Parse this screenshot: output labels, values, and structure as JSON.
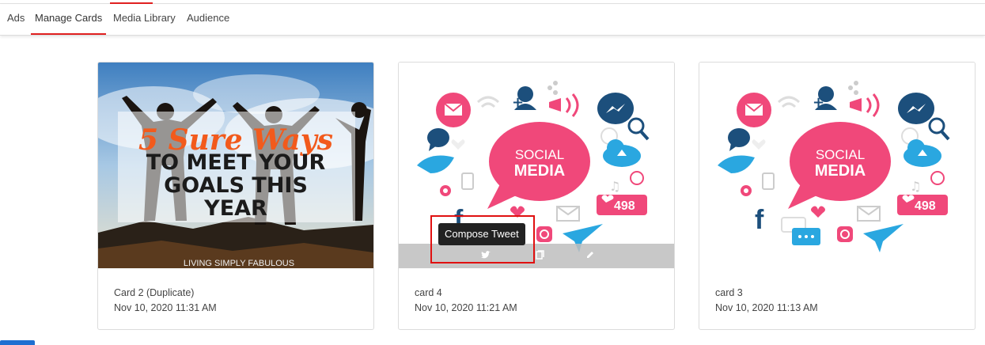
{
  "tabs": [
    {
      "label": "Ads"
    },
    {
      "label": "Manage Cards",
      "active": true
    },
    {
      "label": "Media Library"
    },
    {
      "label": "Audience"
    }
  ],
  "cards": [
    {
      "name": "Card 2 (Duplicate)",
      "date": "Nov 10, 2020 11:31 AM",
      "image": {
        "line1": "5 Sure Ways",
        "line2": "TO MEET YOUR",
        "line3": "GOALS THIS",
        "line4": "YEAR",
        "footer": "LIVING SIMPLY FABULOUS"
      }
    },
    {
      "name": "card 4",
      "date": "Nov 10, 2020 11:21 AM",
      "image": {
        "bubble1": "SOCIAL",
        "bubble2": "MEDIA",
        "likes": "498"
      }
    },
    {
      "name": "card 3",
      "date": "Nov 10, 2020 11:13 AM",
      "image": {
        "bubble1": "SOCIAL",
        "bubble2": "MEDIA",
        "likes": "498"
      }
    }
  ],
  "tooltip": "Compose Tweet",
  "colors": {
    "accent": "#e02020",
    "pink": "#f0487a",
    "navy": "#1c4f7c",
    "sky": "#2aa7e0"
  }
}
